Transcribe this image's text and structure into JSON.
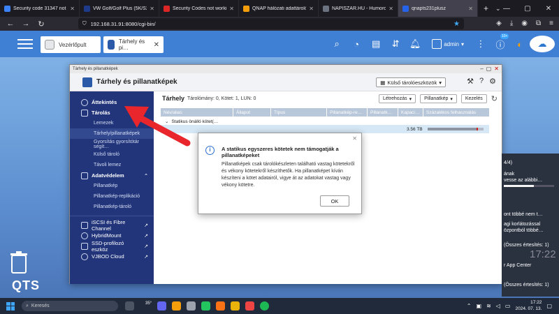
{
  "browser": {
    "tabs": [
      {
        "label": "Security code 31347 not w…",
        "color": "#3b82f6"
      },
      {
        "label": "VW Golf/Golf Plus (5K/S2) Twa…",
        "color": "#1e3a8a"
      },
      {
        "label": "Security Codes not working…",
        "color": "#dc2626"
      },
      {
        "label": "QNAP hálózati adattároló…",
        "color": "#f59e0b"
      },
      {
        "label": "NAPISZAR.HU - Humoros…",
        "color": "#6b7280"
      },
      {
        "label": "qnapts231plusz",
        "color": "#2563eb"
      }
    ],
    "url": "192.168.31.91:8080/cgi-bin/"
  },
  "qts": {
    "tabs": [
      {
        "label": "Vezérlőpult"
      },
      {
        "label": "Tárhely és pi…"
      }
    ],
    "user": "admin",
    "notif_badge": "10+",
    "desktop_label": "QTS"
  },
  "app": {
    "window_title": "Tárhely és pillanatképek",
    "header_title": "Tárhely és pillanatképek",
    "external_devices": "Külső tárolóeszközök",
    "sidebar": {
      "overview": "Áttekintés",
      "storage": "Tárolás",
      "storage_items": [
        "Lemezek",
        "Tárhely/pillanatképek",
        "Gyorsítás gyorsítótár segít…",
        "Külső tároló",
        "Távoli lemez"
      ],
      "protection": "Adatvédelem",
      "protection_items": [
        "Pillanatkép",
        "Pillanatkép-replikáció",
        "Pillanatkép-tároló"
      ],
      "extra_items": [
        "iSCSI és Fibre Channel",
        "HybridMount",
        "SSD-profilozó eszköz",
        "VJBOD Cloud"
      ]
    },
    "content": {
      "heading": "Tárhely",
      "summary": "Tárolómány: 0, Kötet: 1, LUN: 0",
      "buttons": [
        "Létrehozás",
        "Pillanatkép",
        "Kezelés"
      ],
      "columns": [
        "Név/alias",
        "Állapot",
        "Típus",
        "Pillanatkép-re…",
        "Pillanatk…",
        "Kapaci…",
        "Százalékos felhasználás"
      ],
      "group_label": "Statikus önálló kötet(…",
      "volume_capacity": "3.56 TB",
      "volume_usage": 0.88
    }
  },
  "modal": {
    "title": "A statikus egyszeres kötetek nem támogatják a pillanatképeket",
    "body": "Pillanatképek csak tárolókészleten található vastag kötetekről és vékony kötetekről készíthetők. Ha pillanatképet kíván készíteni a kötet adatairól, vigye át az adatokat vastag vagy vékony kötetre.",
    "ok": "OK"
  },
  "notifications": {
    "lines": [
      "4/4)",
      "ának",
      "vesse az alábbi…",
      "ont többé nem t…",
      "agi korlátozással",
      "özpontból többé…",
      "(Összes értesítés: 1)",
      "r App Center",
      "(Összes értesítés: 1)"
    ],
    "clock": "17:22"
  },
  "taskbar": {
    "search": "Keresés",
    "weather": "35°",
    "time": "17:22",
    "date": "2024. 07. 13."
  }
}
